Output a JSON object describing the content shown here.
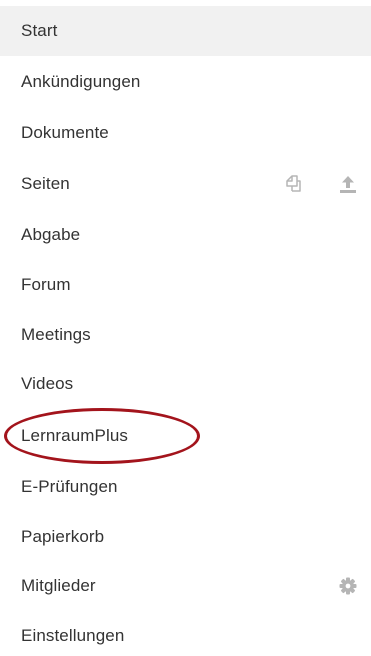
{
  "nav": {
    "items": [
      {
        "label": "Start",
        "active": true
      },
      {
        "label": "Ankündigungen"
      },
      {
        "label": "Dokumente"
      },
      {
        "label": "Seiten"
      },
      {
        "label": "Abgabe"
      },
      {
        "label": "Forum"
      },
      {
        "label": "Meetings"
      },
      {
        "label": "Videos"
      },
      {
        "label": "LernraumPlus"
      },
      {
        "label": "E-Prüfungen"
      },
      {
        "label": "Papierkorb"
      },
      {
        "label": "Mitglieder"
      },
      {
        "label": "Einstellungen"
      }
    ],
    "icons": {
      "seiten_copy": "copy-icon",
      "seiten_upload": "upload-icon",
      "mitglieder_settings": "gear-icon"
    }
  },
  "colors": {
    "text": "#333333",
    "active_background": "#f1f1f1",
    "icon": "#b5b5b5",
    "highlight_ring": "#a3141c"
  }
}
